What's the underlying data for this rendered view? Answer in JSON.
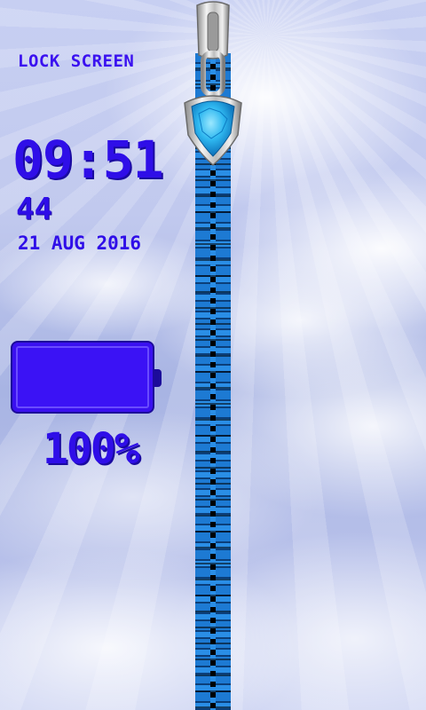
{
  "header": {
    "title": "LOCK SCREEN"
  },
  "clock": {
    "time": "09:51",
    "seconds": "44",
    "date": "21 AUG 2016"
  },
  "battery": {
    "label": "100%",
    "level": 100
  },
  "zipper": {
    "icon": "zipper-pull-icon"
  },
  "colors": {
    "accent": "#2f0ee8",
    "zipper": "#1d7ad3",
    "gem": "#2fb8f0"
  }
}
